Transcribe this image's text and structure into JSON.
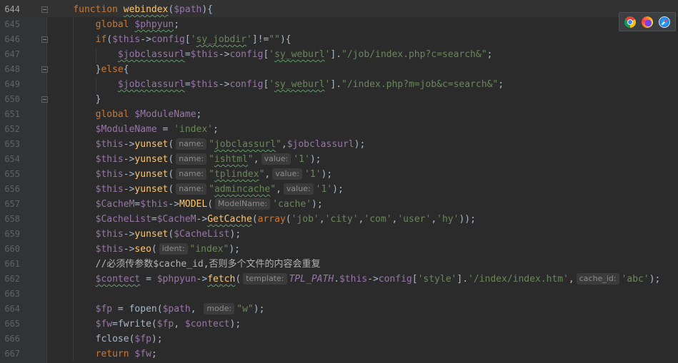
{
  "theme": {
    "background": "#2b2b2b",
    "gutter": "#313335",
    "current_line": "#323232",
    "line_number": "#606366",
    "line_number_current": "#a4a3a3",
    "indent_guide": "#393939",
    "kw": "#cc7832",
    "var": "#9876aa",
    "prop": "#9876aa",
    "str": "#6a8759",
    "fn": "#ffc66d",
    "op": "#a9b7c6",
    "bi": "#a9b7c6",
    "const": "#9876aa",
    "cmt": "#b3b3b3",
    "hint_text": "#8c8c8c",
    "hint_bg": "#3b3b3b",
    "typo": "#659c6b"
  },
  "browser_toolbar": {
    "icons": [
      "chrome-icon",
      "firefox-icon",
      "safari-icon"
    ]
  },
  "editor": {
    "lines": [
      {
        "n": "644",
        "current": true,
        "fold": true,
        "tokens": [
          {
            "ws": "    "
          },
          {
            "kw": "function"
          },
          {
            "op": " "
          },
          {
            "fn": "webindex",
            "typo": true
          },
          {
            "op": "("
          },
          {
            "var": "$path"
          },
          {
            "op": "){"
          }
        ]
      },
      {
        "n": "645",
        "tokens": [
          {
            "ws": "        "
          },
          {
            "kw": "global"
          },
          {
            "op": " "
          },
          {
            "var": "$phpyun",
            "typo": true
          },
          {
            "op": ";"
          }
        ]
      },
      {
        "n": "646",
        "fold": true,
        "tokens": [
          {
            "ws": "        "
          },
          {
            "kw": "if"
          },
          {
            "op": "("
          },
          {
            "var": "$this"
          },
          {
            "op": "->"
          },
          {
            "prop": "config"
          },
          {
            "op": "["
          },
          {
            "str": "'"
          },
          {
            "str": "sy_jobdir",
            "typo": true
          },
          {
            "str": "'"
          },
          {
            "op": "]!="
          },
          {
            "str": "\"\""
          },
          {
            "op": "){"
          }
        ]
      },
      {
        "n": "647",
        "tokens": [
          {
            "ws": "            "
          },
          {
            "var": "$jobclassurl",
            "typo": true
          },
          {
            "op": "="
          },
          {
            "var": "$this"
          },
          {
            "op": "->"
          },
          {
            "prop": "config"
          },
          {
            "op": "["
          },
          {
            "str": "'"
          },
          {
            "str": "sy_weburl",
            "typo": true
          },
          {
            "str": "'"
          },
          {
            "op": "]."
          },
          {
            "str": "\"/job/index.php?c=search&\""
          },
          {
            "op": ";"
          }
        ]
      },
      {
        "n": "648",
        "fold": true,
        "tokens": [
          {
            "ws": "        "
          },
          {
            "op": "}"
          },
          {
            "kw": "else"
          },
          {
            "op": "{"
          }
        ]
      },
      {
        "n": "649",
        "tokens": [
          {
            "ws": "            "
          },
          {
            "var": "$jobclassurl",
            "typo": true
          },
          {
            "op": "="
          },
          {
            "var": "$this"
          },
          {
            "op": "->"
          },
          {
            "prop": "config"
          },
          {
            "op": "["
          },
          {
            "str": "'"
          },
          {
            "str": "sy_weburl",
            "typo": true
          },
          {
            "str": "'"
          },
          {
            "op": "]."
          },
          {
            "str": "\"/index.php?m=job&c=search&\""
          },
          {
            "op": ";"
          }
        ]
      },
      {
        "n": "650",
        "fold": true,
        "tokens": [
          {
            "ws": "        "
          },
          {
            "op": "}"
          }
        ]
      },
      {
        "n": "651",
        "tokens": [
          {
            "ws": "        "
          },
          {
            "kw": "global"
          },
          {
            "op": " "
          },
          {
            "var": "$ModuleName"
          },
          {
            "op": ";"
          }
        ]
      },
      {
        "n": "652",
        "tokens": [
          {
            "ws": "        "
          },
          {
            "var": "$ModuleName"
          },
          {
            "op": " = "
          },
          {
            "str": "'index'"
          },
          {
            "op": ";"
          }
        ]
      },
      {
        "n": "653",
        "tokens": [
          {
            "ws": "        "
          },
          {
            "var": "$this"
          },
          {
            "op": "->"
          },
          {
            "fn": "yunset"
          },
          {
            "op": "("
          },
          {
            "hint": "name:"
          },
          {
            "str": "\""
          },
          {
            "str": "jobclassurl",
            "typo": true
          },
          {
            "str": "\""
          },
          {
            "op": ","
          },
          {
            "var": "$jobclassurl"
          },
          {
            "op": ");"
          }
        ]
      },
      {
        "n": "654",
        "tokens": [
          {
            "ws": "        "
          },
          {
            "var": "$this"
          },
          {
            "op": "->"
          },
          {
            "fn": "yunset"
          },
          {
            "op": "("
          },
          {
            "hint": "name:"
          },
          {
            "str": "\""
          },
          {
            "str": "ishtml",
            "typo": true
          },
          {
            "str": "\""
          },
          {
            "op": ","
          },
          {
            "hint": "value:"
          },
          {
            "str": "'1'"
          },
          {
            "op": ");"
          }
        ]
      },
      {
        "n": "655",
        "tokens": [
          {
            "ws": "        "
          },
          {
            "var": "$this"
          },
          {
            "op": "->"
          },
          {
            "fn": "yunset"
          },
          {
            "op": "("
          },
          {
            "hint": "name:"
          },
          {
            "str": "\""
          },
          {
            "str": "tplindex",
            "typo": true
          },
          {
            "str": "\""
          },
          {
            "op": ","
          },
          {
            "hint": "value:"
          },
          {
            "str": "'1'"
          },
          {
            "op": ");"
          }
        ]
      },
      {
        "n": "656",
        "tokens": [
          {
            "ws": "        "
          },
          {
            "var": "$this"
          },
          {
            "op": "->"
          },
          {
            "fn": "yunset"
          },
          {
            "op": "("
          },
          {
            "hint": "name:"
          },
          {
            "str": "\""
          },
          {
            "str": "admincache",
            "typo": true
          },
          {
            "str": "\""
          },
          {
            "op": ","
          },
          {
            "hint": "value:"
          },
          {
            "str": "'1'"
          },
          {
            "op": ");"
          }
        ]
      },
      {
        "n": "657",
        "tokens": [
          {
            "ws": "        "
          },
          {
            "var": "$CacheM"
          },
          {
            "op": "="
          },
          {
            "var": "$this"
          },
          {
            "op": "->"
          },
          {
            "fn": "MODEL"
          },
          {
            "op": "("
          },
          {
            "hint": "ModelName:"
          },
          {
            "str": "'cache'"
          },
          {
            "op": ");"
          }
        ]
      },
      {
        "n": "658",
        "tokens": [
          {
            "ws": "        "
          },
          {
            "var": "$CacheList"
          },
          {
            "op": "="
          },
          {
            "var": "$CacheM"
          },
          {
            "op": "->"
          },
          {
            "fn": "GetCache",
            "typo": true
          },
          {
            "op": "("
          },
          {
            "kw": "array"
          },
          {
            "op": "("
          },
          {
            "str": "'job'"
          },
          {
            "op": ","
          },
          {
            "str": "'city'"
          },
          {
            "op": ","
          },
          {
            "str": "'com'"
          },
          {
            "op": ","
          },
          {
            "str": "'user'"
          },
          {
            "op": ","
          },
          {
            "str": "'hy'"
          },
          {
            "op": "));"
          }
        ]
      },
      {
        "n": "659",
        "tokens": [
          {
            "ws": "        "
          },
          {
            "var": "$this"
          },
          {
            "op": "->"
          },
          {
            "fn": "yunset"
          },
          {
            "op": "("
          },
          {
            "var": "$CacheList"
          },
          {
            "op": ");"
          }
        ]
      },
      {
        "n": "660",
        "tokens": [
          {
            "ws": "        "
          },
          {
            "var": "$this"
          },
          {
            "op": "->"
          },
          {
            "fn": "seo"
          },
          {
            "op": "("
          },
          {
            "hint": "ident:"
          },
          {
            "str": "\"index\""
          },
          {
            "op": ");"
          }
        ]
      },
      {
        "n": "661",
        "tokens": [
          {
            "ws": "        "
          },
          {
            "cmt": "//必须传参数$cache_id,否则多个文件的内容会重复"
          }
        ]
      },
      {
        "n": "662",
        "tokens": [
          {
            "ws": "        "
          },
          {
            "var": "$contect",
            "typo": true
          },
          {
            "op": " = "
          },
          {
            "var": "$phpyun"
          },
          {
            "op": "->"
          },
          {
            "fn": "fetch",
            "typo": true
          },
          {
            "op": "("
          },
          {
            "hint": "template:"
          },
          {
            "const": "TPL_PATH"
          },
          {
            "op": "."
          },
          {
            "var": "$this"
          },
          {
            "op": "->"
          },
          {
            "prop": "config"
          },
          {
            "op": "["
          },
          {
            "str": "'style'"
          },
          {
            "op": "]."
          },
          {
            "str": "'/index/index.htm'"
          },
          {
            "op": ","
          },
          {
            "hint": "cache_id:"
          },
          {
            "str": "'abc'"
          },
          {
            "op": ");"
          }
        ]
      },
      {
        "n": "663",
        "tokens": []
      },
      {
        "n": "664",
        "tokens": [
          {
            "ws": "        "
          },
          {
            "var": "$fp"
          },
          {
            "op": " = "
          },
          {
            "bi": "fopen"
          },
          {
            "op": "("
          },
          {
            "var": "$path"
          },
          {
            "op": ", "
          },
          {
            "hint": "mode:"
          },
          {
            "str": "\"w\""
          },
          {
            "op": ");"
          }
        ]
      },
      {
        "n": "665",
        "tokens": [
          {
            "ws": "        "
          },
          {
            "var": "$fw"
          },
          {
            "op": "="
          },
          {
            "bi": "fwrite"
          },
          {
            "op": "("
          },
          {
            "var": "$fp"
          },
          {
            "op": ", "
          },
          {
            "var": "$contect"
          },
          {
            "op": ");"
          }
        ]
      },
      {
        "n": "666",
        "tokens": [
          {
            "ws": "        "
          },
          {
            "bi": "fclose"
          },
          {
            "op": "("
          },
          {
            "var": "$fp"
          },
          {
            "op": ");"
          }
        ]
      },
      {
        "n": "667",
        "tokens": [
          {
            "ws": "        "
          },
          {
            "kw": "return"
          },
          {
            "op": " "
          },
          {
            "var": "$fw"
          },
          {
            "op": ";"
          }
        ]
      }
    ]
  }
}
